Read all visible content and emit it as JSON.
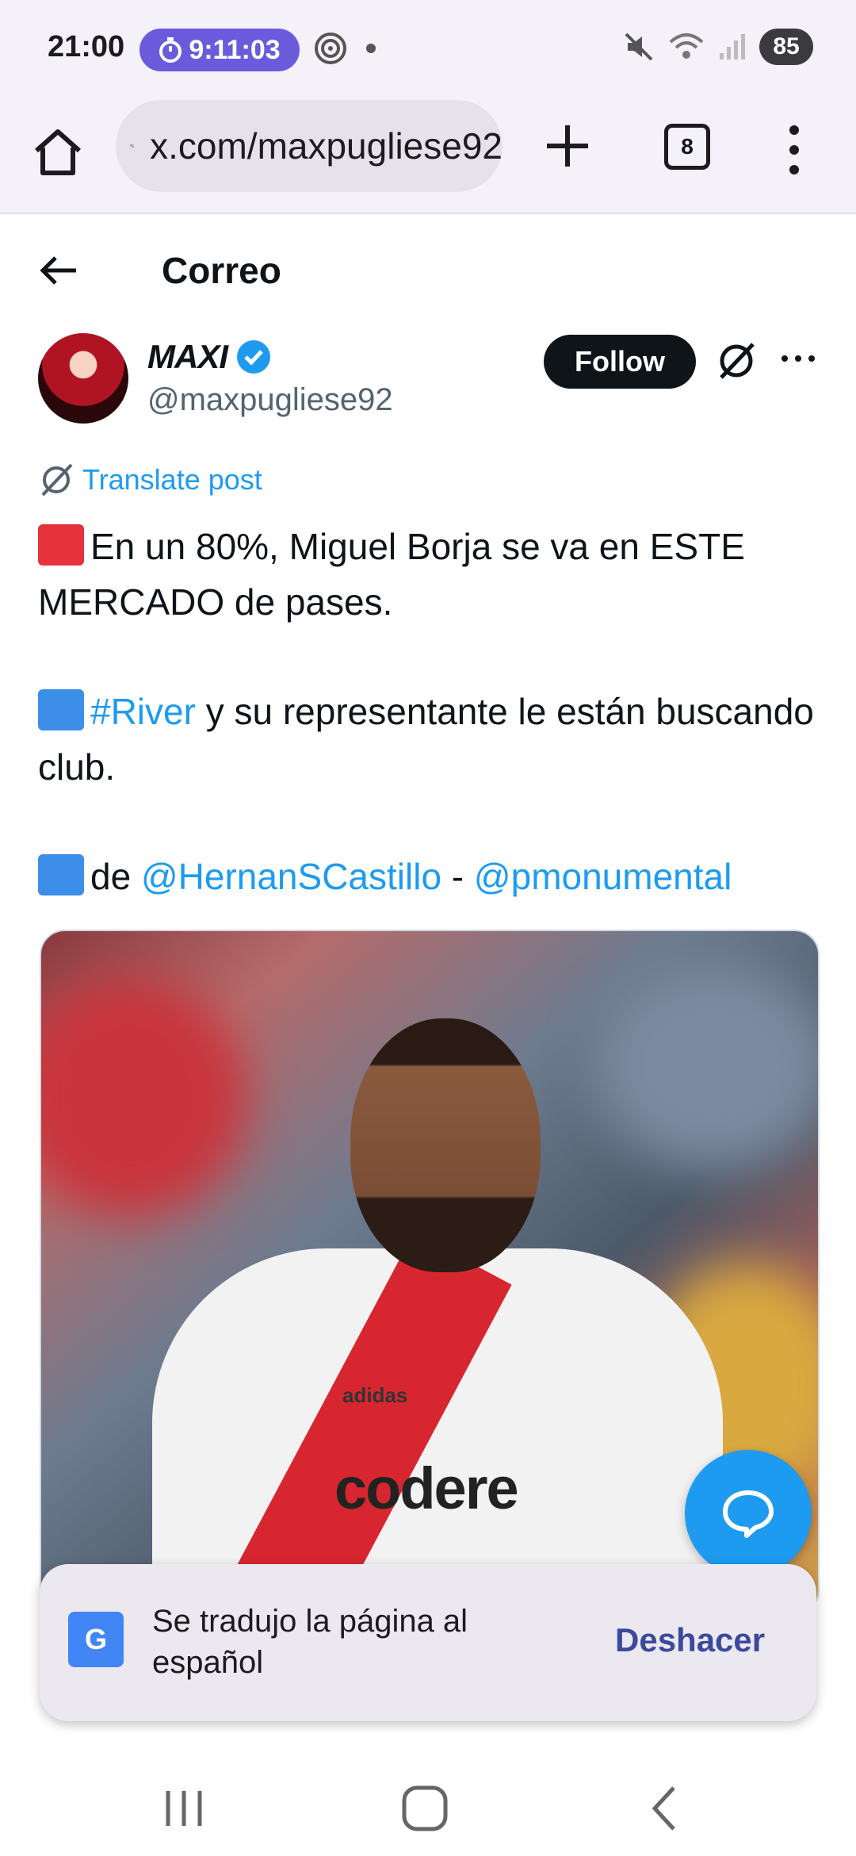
{
  "status_bar": {
    "time": "21:00",
    "timer": "9:11:03",
    "battery": "85"
  },
  "browser": {
    "url": "x.com/maxpugliese92",
    "tab_count": "8"
  },
  "header": {
    "title": "Correo"
  },
  "post": {
    "display_name": "MAXI",
    "handle": "@maxpugliese92",
    "follow_label": "Follow",
    "translate_label": "Translate post",
    "line1": "En un 80%, Miguel Borja se va en ESTE MERCADO de pases.",
    "line2_link": "#River",
    "line2_rest": " y su representante le están buscando club.",
    "line3_prefix": "de ",
    "mention1": "@HernanSCastillo",
    "separator": " - ",
    "mention2": "@pmonumental",
    "image": {
      "sponsor": "codere",
      "brand": "adidas"
    }
  },
  "toast": {
    "message": "Se tradujo la página al español",
    "action": "Deshacer"
  },
  "colors": {
    "link": "#1d9bf0",
    "follow_bg": "#0f1419",
    "fab": "#1d9bf0",
    "timer_pill": "#6b5bdc"
  }
}
